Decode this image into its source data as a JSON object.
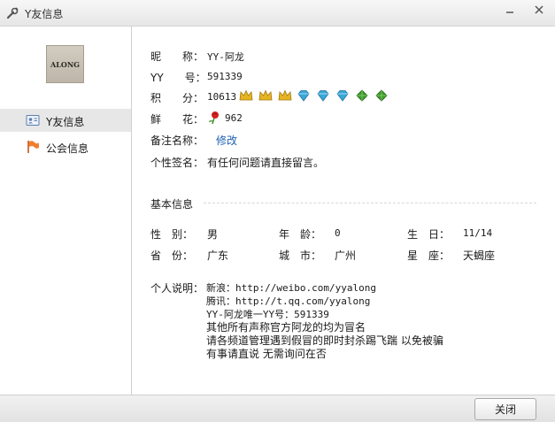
{
  "window": {
    "title": "Y友信息"
  },
  "sidebar": {
    "avatar_text": "ALONG",
    "items": [
      {
        "label": "Y友信息",
        "active": true
      },
      {
        "label": "公会信息",
        "active": false
      }
    ]
  },
  "profile": {
    "nickname": {
      "label": "昵　　称：",
      "value": "YY-阿龙"
    },
    "yy_number": {
      "label": "YY　　号：",
      "value": "591339"
    },
    "points": {
      "label": "积　　分：",
      "value": "10613"
    },
    "flowers": {
      "label": "鲜　　花：",
      "value": "962"
    },
    "remark": {
      "label": "备注名称：",
      "link": "修改"
    },
    "signature": {
      "label": "个性签名：",
      "value": "有任何问题请直接留言。"
    }
  },
  "basic": {
    "title": "基本信息",
    "gender": {
      "label": "性　别：",
      "value": "男"
    },
    "age": {
      "label": "年　龄：",
      "value": "0"
    },
    "birthday": {
      "label": "生　日：",
      "value": "11/14"
    },
    "province": {
      "label": "省　份：",
      "value": "广东"
    },
    "city": {
      "label": "城　市：",
      "value": "广州"
    },
    "zodiac": {
      "label": "星　座：",
      "value": "天蝎座"
    },
    "intro_label": "个人说明：",
    "intro_lines": [
      "新浪：http://weibo.com/yyalong",
      "腾讯：http://t.qq.com/yyalong",
      "YY-阿龙唯一YY号：591339",
      "其他所有声称官方阿龙的均为冒名",
      "请各频道管理遇到假冒的即时封杀踢飞踹 以免被骗",
      "有事请直说 无需询问在否"
    ]
  },
  "footer": {
    "close_label": "关闭"
  },
  "colors": {
    "link": "#1f5fb0",
    "active_nav": "#e7e7e7",
    "crown": "#e6b422",
    "diamond": "#3aa7d8",
    "leaf": "#3e9a2c"
  },
  "icons": {
    "title": "wrench-icon",
    "nav": [
      "contact-card-icon",
      "flag-icon"
    ],
    "level_badges": [
      "crown-icon",
      "crown-icon",
      "crown-icon",
      "diamond-icon",
      "diamond-icon",
      "diamond-icon",
      "leaf-icon",
      "leaf-icon"
    ],
    "flower": "rose-icon"
  }
}
